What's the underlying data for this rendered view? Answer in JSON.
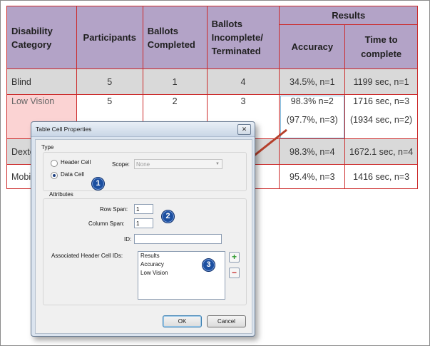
{
  "table": {
    "headers": {
      "disability_category": "Disability Category",
      "participants": "Participants",
      "ballots_completed": "Ballots Completed",
      "ballots_incomplete": "Ballots Incomplete/ Terminated",
      "results": "Results",
      "accuracy": "Accuracy",
      "time_to_complete": "Time to complete"
    },
    "rows": [
      {
        "category": "Blind",
        "participants": "5",
        "completed": "1",
        "incomplete": "4",
        "accuracy": "34.5%, n=1",
        "time": "1199 sec, n=1"
      },
      {
        "category": "Low Vision",
        "participants": "5",
        "completed": "2",
        "incomplete": "3",
        "accuracy": "98.3% n=2",
        "accuracy2": "(97.7%, n=3)",
        "time": "1716 sec, n=3",
        "time2": "(1934 sec, n=2)"
      },
      {
        "category": "Dexte",
        "accuracy": "98.3%, n=4",
        "time": "1672.1 sec, n=4"
      },
      {
        "category": "Mobi",
        "accuracy": "95.4%, n=3",
        "time": "1416 sec, n=3"
      }
    ]
  },
  "dialog": {
    "title": "Table Cell Properties",
    "close": "✕",
    "type_group": "Type",
    "header_cell": "Header Cell",
    "data_cell": "Data Cell",
    "scope_label": "Scope:",
    "scope_value": "None",
    "attributes_group": "Attributes",
    "row_span_label": "Row Span:",
    "row_span_value": "1",
    "column_span_label": "Column Span:",
    "column_span_value": "1",
    "id_label": "ID:",
    "id_value": "",
    "assoc_label": "Associated Header Cell IDs:",
    "assoc_items": [
      "Results",
      "Accuracy",
      "Low Vision"
    ],
    "add_button": "+",
    "remove_button": "−",
    "ok": "OK",
    "cancel": "Cancel"
  },
  "badges": {
    "one": "1",
    "two": "2",
    "three": "3"
  },
  "colors": {
    "header_bg": "#b3a3c7",
    "border": "#cc2a2a",
    "highlight_row": "#d9d9d9",
    "selected_cell": "#fbd3d3",
    "arrow": "#b5402c",
    "badge": "#1c4fa0"
  }
}
